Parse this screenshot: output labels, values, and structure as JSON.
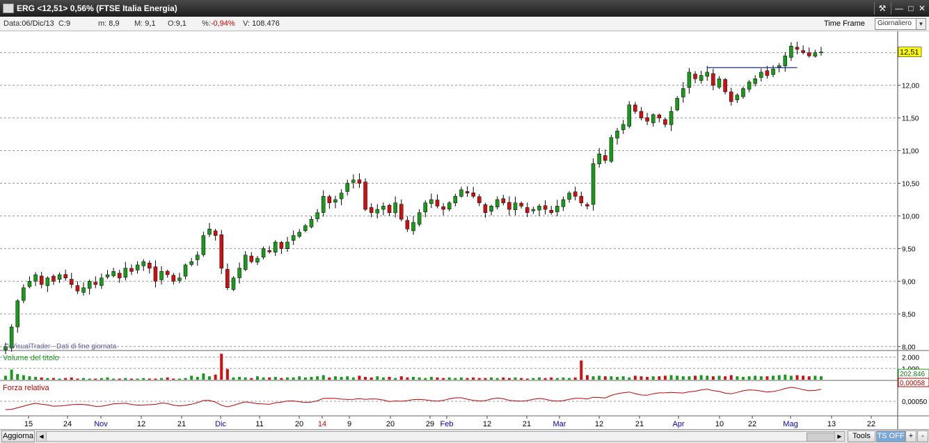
{
  "window": {
    "title": "ERG <12,51> 0,56%  (FTSE Italia Energia)",
    "buttons": [
      "wrench-icon",
      "minimize-icon",
      "maximize-icon",
      "close-icon"
    ]
  },
  "infobar": {
    "date_label": "Data:",
    "date": "06/Dic/13",
    "c_label": "C:",
    "c": "9",
    "min_label": "m:",
    "min": "8,9",
    "max_label": "M:",
    "max": "9,1",
    "open_label": "O:",
    "open": "9,1",
    "pct_label": "%:",
    "pct": "-0,94%",
    "vol_label": "V:",
    "vol": "108.476",
    "timeframe_label": "Time Frame",
    "timeframe_value": "Giornaliero"
  },
  "chart_data": {
    "type": "candlestick",
    "watermark": "© VisualTrader - Dati di fine giornata",
    "last_price_label": "12,51",
    "y_ticks": [
      "12,50",
      "12,00",
      "11,50",
      "11,00",
      "10,50",
      "10,00",
      "9,50",
      "9,00",
      "8,50",
      "8,00"
    ],
    "ylim": [
      7.95,
      12.72
    ],
    "x_ticks": [
      "15",
      "24",
      "Nov",
      "12",
      "21",
      "Dic",
      "11",
      "20",
      "14",
      "9",
      "20",
      "29",
      "Feb",
      "12",
      "21",
      "Mar",
      "12",
      "21",
      "Apr",
      "10",
      "22",
      "Mag",
      "13",
      "22"
    ],
    "x_tick_colors": [
      "#000",
      "#000",
      "#0000c8",
      "#000",
      "#000",
      "#0000c8",
      "#000",
      "#000",
      "#d00000",
      "#000",
      "#000",
      "#000",
      "#0000c8",
      "#000",
      "#000",
      "#0000c8",
      "#000",
      "#000",
      "#0000c8",
      "#000",
      "#000",
      "#0000c8",
      "#000",
      "#000"
    ],
    "close_series": [
      8.0,
      8.3,
      8.7,
      8.9,
      9.0,
      9.1,
      8.95,
      9.05,
      9.0,
      9.1,
      9.05,
      8.95,
      8.85,
      8.9,
      9.0,
      8.95,
      9.05,
      9.1,
      9.15,
      9.05,
      9.2,
      9.15,
      9.25,
      9.3,
      9.2,
      9.0,
      9.15,
      9.1,
      9.0,
      9.05,
      9.25,
      9.3,
      9.4,
      9.7,
      9.8,
      9.7,
      9.2,
      8.9,
      9.05,
      9.2,
      9.4,
      9.3,
      9.35,
      9.5,
      9.45,
      9.6,
      9.5,
      9.6,
      9.7,
      9.75,
      9.85,
      9.95,
      10.05,
      10.3,
      10.2,
      10.25,
      10.35,
      10.5,
      10.55,
      10.5,
      10.1,
      10.05,
      10.1,
      10.15,
      10.05,
      10.2,
      9.95,
      9.8,
      9.9,
      10.05,
      10.2,
      10.25,
      10.15,
      10.1,
      10.2,
      10.3,
      10.4,
      10.35,
      10.3,
      10.2,
      10.05,
      10.15,
      10.25,
      10.2,
      10.1,
      10.2,
      10.15,
      10.05,
      10.1,
      10.15,
      10.1,
      10.05,
      10.15,
      10.25,
      10.35,
      10.3,
      10.2,
      10.15,
      10.8,
      10.95,
      10.85,
      11.2,
      11.3,
      11.4,
      11.7,
      11.6,
      11.5,
      11.45,
      11.55,
      11.5,
      11.4,
      11.6,
      11.8,
      11.95,
      12.2,
      12.1,
      12.15,
      12.2,
      12.0,
      12.1,
      11.9,
      11.75,
      11.85,
      11.95,
      12.05,
      12.1,
      12.2,
      12.15,
      12.25,
      12.3,
      12.45,
      12.6,
      12.55,
      12.5,
      12.45,
      12.5,
      12.51
    ],
    "resistance_line": {
      "from_index": 117,
      "to_index": 132,
      "value": 12.27
    },
    "volume": {
      "title": "Volume del titolo",
      "y_ticks": [
        "2.000",
        "1.000"
      ],
      "last_label": "202.846",
      "bars": [
        0.35,
        0.9,
        0.5,
        0.4,
        0.3,
        0.25,
        0.2,
        0.15,
        0.15,
        0.1,
        0.15,
        0.2,
        0.1,
        0.15,
        0.1,
        0.1,
        0.15,
        0.2,
        0.1,
        0.1,
        0.15,
        0.1,
        0.1,
        0.15,
        0.1,
        0.1,
        0.15,
        0.2,
        0.1,
        0.1,
        0.15,
        0.35,
        0.25,
        0.55,
        0.3,
        0.45,
        2.3,
        0.95,
        0.2,
        0.25,
        0.2,
        0.15,
        0.3,
        0.2,
        0.2,
        0.25,
        0.15,
        0.2,
        0.2,
        0.3,
        0.2,
        0.25,
        0.3,
        0.4,
        0.2,
        0.3,
        0.25,
        0.3,
        0.2,
        0.35,
        0.25,
        0.2,
        0.3,
        0.2,
        0.25,
        0.15,
        0.3,
        0.2,
        0.25,
        0.2,
        0.15,
        0.25,
        0.2,
        0.15,
        0.2,
        0.15,
        0.2,
        0.15,
        0.2,
        0.15,
        0.15,
        0.2,
        0.15,
        0.2,
        0.15,
        0.2,
        0.15,
        0.1,
        0.15,
        0.2,
        0.15,
        0.2,
        0.15,
        0.2,
        0.15,
        0.2,
        1.7,
        0.4,
        0.3,
        0.35,
        0.3,
        0.3,
        0.25,
        0.3,
        0.2,
        0.35,
        0.3,
        0.25,
        0.3,
        0.3,
        0.35,
        0.4,
        0.35,
        0.3,
        0.3,
        0.35,
        0.4,
        0.35,
        0.3,
        0.35,
        0.3,
        0.4,
        0.3,
        0.25,
        0.3,
        0.35,
        0.3,
        0.3,
        0.35,
        0.4,
        0.45,
        0.35,
        0.4,
        0.35,
        0.3,
        0.35,
        0.3
      ]
    },
    "relative_strength": {
      "title": "Forza relativa",
      "y_ticks": [
        "0,00050"
      ],
      "last_label": "0,00058"
    }
  },
  "bottombar": {
    "refresh_label": "Aggiorna",
    "tools_label": "Tools",
    "ts_label": "TS OFF",
    "plus_label": "+",
    "minus_label": "-"
  },
  "colors": {
    "up": "#1a9a1a",
    "down": "#d01010",
    "rs_line": "#c00000",
    "resistance": "#1c2c8c",
    "price_tag": "#ffff00"
  }
}
